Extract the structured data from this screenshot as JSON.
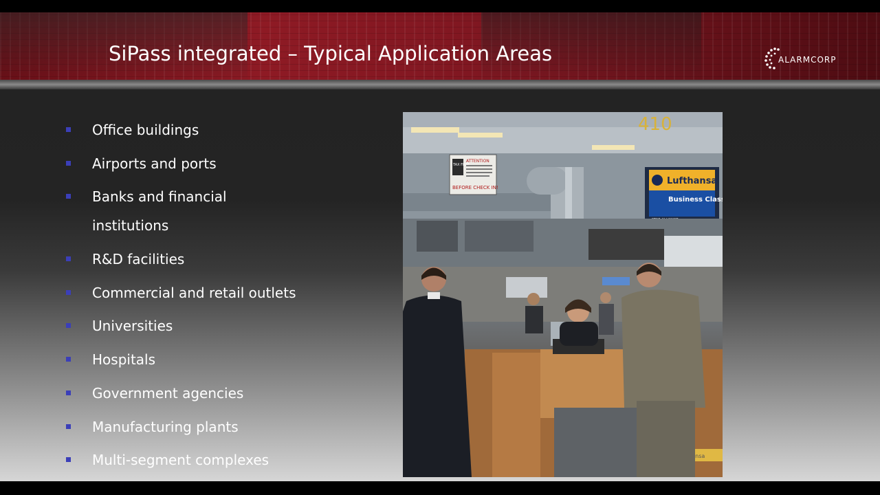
{
  "header": {
    "title": "SiPass integrated – Typical Application Areas",
    "logo_text": "ALARMCORP",
    "accent_color": "#8e1a24"
  },
  "bullets": [
    "Office buildings",
    "Airports and ports",
    "Banks and financial institutions",
    "R&D facilities",
    "Commercial and retail outlets",
    "Universities",
    "Hospitals",
    "Government agencies",
    "Manufacturing plants",
    "Multi-segment complexes"
  ],
  "bullet_color": "#3b3fb8",
  "photo": {
    "gate_number": "410",
    "sign_airline": "Lufthansa",
    "sign_class": "Business Class",
    "sign_alliance": "STAR ALLIANCE",
    "notice_title": "ATTENTION",
    "notice_footer": "BEFORE CHECK IN!",
    "notice_logo": "TAX FREE",
    "counter_label": "Lufthansa"
  }
}
